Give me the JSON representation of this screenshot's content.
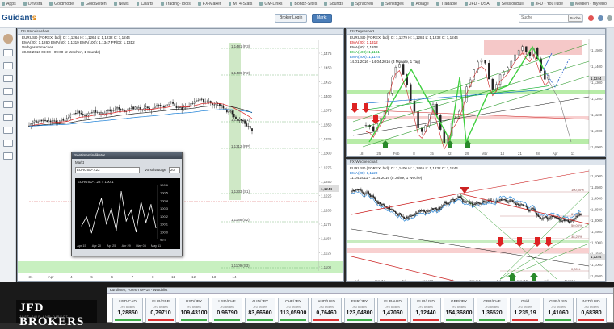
{
  "bookmarks": [
    "Apps",
    "Onvista",
    "Goldmode",
    "GoldSeiten",
    "News",
    "Charts",
    "Trading-Tools",
    "FX-Maker",
    "MT4-Stats",
    "GM-Links",
    "Bondz-Sites",
    "Sounds",
    "Sprachen",
    "Sonstiges",
    "Ablage",
    "Tradable",
    "JFD - DSA",
    "SessionBull",
    "JFD - YouTube",
    "Medien - myrebo"
  ],
  "header": {
    "logo_a": "Guidant",
    "logo_b": "s",
    "btn_login": "Broker Login",
    "btn_markt": "Markt",
    "search_placeholder": "Suche",
    "search_button": "Suche"
  },
  "pane_left": {
    "title": "FX-Stundenchart",
    "info": [
      "EURUSD (FOREX, bid): O: 1,1264 H: 1,1264 L: 1,1232 C: 1,1244",
      "EMA(20): 1,1260  EMA(50): 1,1319  EMA(100): 1,1347  PP(D): 1,1312",
      "Vorbgesetzmacher",
      "30.03.2016 08:00 - 09:00 (2 Wochen, 1 Stunde)"
    ],
    "levels": [
      {
        "p": "1,1481 (R3)",
        "c": "#444"
      },
      {
        "p": "1,1436 (R2)",
        "c": "#444"
      },
      {
        "p": "1,1357 (R1)",
        "c": "#444"
      },
      {
        "p": "1,1312 (PP)",
        "c": "#444"
      },
      {
        "p": "1,1233 (S1)",
        "c": "#444"
      },
      {
        "p": "1,1188 (S2)",
        "c": "#444"
      },
      {
        "p": "1,1109 (S3)",
        "c": "#444"
      }
    ],
    "yticks": [
      "1,1475",
      "1,1450",
      "1,1425",
      "1,1400",
      "1,1375",
      "1,1350",
      "1,1325",
      "1,1300",
      "1,1275",
      "1,1250",
      "1,1225",
      "1,1200",
      "1,1175",
      "1,1150",
      "1,1125",
      "1,1100"
    ],
    "price_tag": "1,1244",
    "xticks": [
      "31",
      "Apr",
      "4",
      "5",
      "6",
      "7",
      "8",
      "11",
      "12",
      "13",
      "14"
    ]
  },
  "indicator": {
    "title": "Sentimentindikator",
    "markt_label": "Markt",
    "markt_value": "EURUSD-7.22",
    "vorschau_label": "Vorschautage",
    "vorschau_value": "20",
    "series_label": "EURUSD-7.22 = 100.1",
    "yticks": [
      "100.6",
      "100.5",
      "100.4",
      "100.3",
      "100.2",
      "100.1",
      "100.0",
      "99.9"
    ],
    "xticks": [
      "Apr 15",
      "Apr 20",
      "Apr 25",
      "Apr 29",
      "May 05",
      "May 11"
    ],
    "chart_data": {
      "type": "line",
      "x": [
        "Apr 15",
        "Apr 20",
        "Apr 25",
        "Apr 29",
        "May 05",
        "May 11"
      ],
      "series": [
        {
          "name": "EURUSD-7.22",
          "values": [
            100.05,
            100.18,
            99.95,
            100.22,
            100.45,
            100.08,
            100.3,
            99.98,
            100.55,
            100.12,
            100.28,
            99.96,
            100.4,
            100.1,
            100.36,
            100.02
          ]
        }
      ],
      "ylim": [
        99.85,
        100.65
      ]
    }
  },
  "pane_rt": {
    "title": "FX-Tageschart",
    "info": [
      "EURUSD (FOREX, bid): O: 1,1279 H: 1,1284 L: 1,1232 C: 1,1244",
      "EMA(20): 1,1312",
      "EMA(50): 1,1203",
      "EMA(100): 1,1161",
      "EMA(200): 1,1174",
      "14.01.2016 - 14.04.2016 (3 Monate, 1 Tag)"
    ],
    "yticks": [
      "1,1500",
      "1,1400",
      "1,1300",
      "1,1200",
      "1,1100",
      "1,1000",
      "1,0900"
    ],
    "price_tag": "1,1244",
    "xticks": [
      "18",
      "25",
      "Feb",
      "8",
      "15",
      "22",
      "29",
      "Mär",
      "14",
      "21",
      "28",
      "Apr",
      "11"
    ]
  },
  "pane_rb": {
    "title": "FX-Wochenchart",
    "info": [
      "EURUSD (FOREX, bid): O: 1,1406 H: 1,1465 L: 1,1232 C: 1,1244",
      "EMA(20): 1,1120",
      "11.04.2011 - 11.04.2016 (5 Jahre, 1 Woche)"
    ],
    "yticks": [
      "1,5000",
      "1,4500",
      "1,4000",
      "1,3500",
      "1,3000",
      "1,2500",
      "1,2000",
      "1,1500",
      "1,1000",
      "1,0500"
    ],
    "fib": [
      "100,00%",
      "61,80%",
      "50,00%",
      "38,20%",
      "23,60%",
      "0,00%"
    ],
    "price_tag": "1,1244",
    "xticks": [
      "Jul",
      "Jan '12",
      "Jul",
      "Jan '13",
      "Jul",
      "Jan '14",
      "Jul",
      "Jan '15",
      "Jul",
      "Jan '16"
    ]
  },
  "bottom": {
    "brand": "JFD BROKERS",
    "tagline": "JUST FAIR AND DIRECT",
    "window_title": "Kurslisten, Forex-TOP-15 - Watchlist"
  },
  "watchlist": [
    {
      "name": "USD/CAD",
      "src": "JFD Brokers",
      "value": "1,28850",
      "dir": "up"
    },
    {
      "name": "EUR/GBP",
      "src": "JFD Brokers",
      "value": "0,79710",
      "dir": "dn"
    },
    {
      "name": "USD/JPY",
      "src": "JFD Brokers",
      "value": "109,43100",
      "dir": "up"
    },
    {
      "name": "USD/CHF",
      "src": "JFD Brokers",
      "value": "0,96790",
      "dir": "up"
    },
    {
      "name": "AUD/JPY",
      "src": "JFD Brokers",
      "value": "83,66600",
      "dir": "up"
    },
    {
      "name": "CHF/JPY",
      "src": "JFD Brokers",
      "value": "113,05900",
      "dir": "up"
    },
    {
      "name": "AUD/USD",
      "src": "JFD Brokers",
      "value": "0,76460",
      "dir": "dn"
    },
    {
      "name": "EUR/JPY",
      "src": "JFD Brokers",
      "value": "123,04800",
      "dir": "up"
    },
    {
      "name": "EUR/AUD",
      "src": "JFD Brokers",
      "value": "1,47060",
      "dir": "dn"
    },
    {
      "name": "EUR/USD",
      "src": "JFD Brokers",
      "value": "1,12440",
      "dir": "dn"
    },
    {
      "name": "GBP/JPY",
      "src": "JFD Brokers",
      "value": "154,36800",
      "dir": "up"
    },
    {
      "name": "GBP/CHF",
      "src": "JFD Brokers",
      "value": "1,36520",
      "dir": "up"
    },
    {
      "name": "Gold",
      "src": "JFD Brokers",
      "value": "1.235,19",
      "dir": "dn"
    },
    {
      "name": "GBP/USD",
      "src": "JFD Brokers",
      "value": "1,41060",
      "dir": "up"
    },
    {
      "name": "NZD/USD",
      "src": "JFD Brokers",
      "value": "0,68380",
      "dir": "dn"
    }
  ]
}
